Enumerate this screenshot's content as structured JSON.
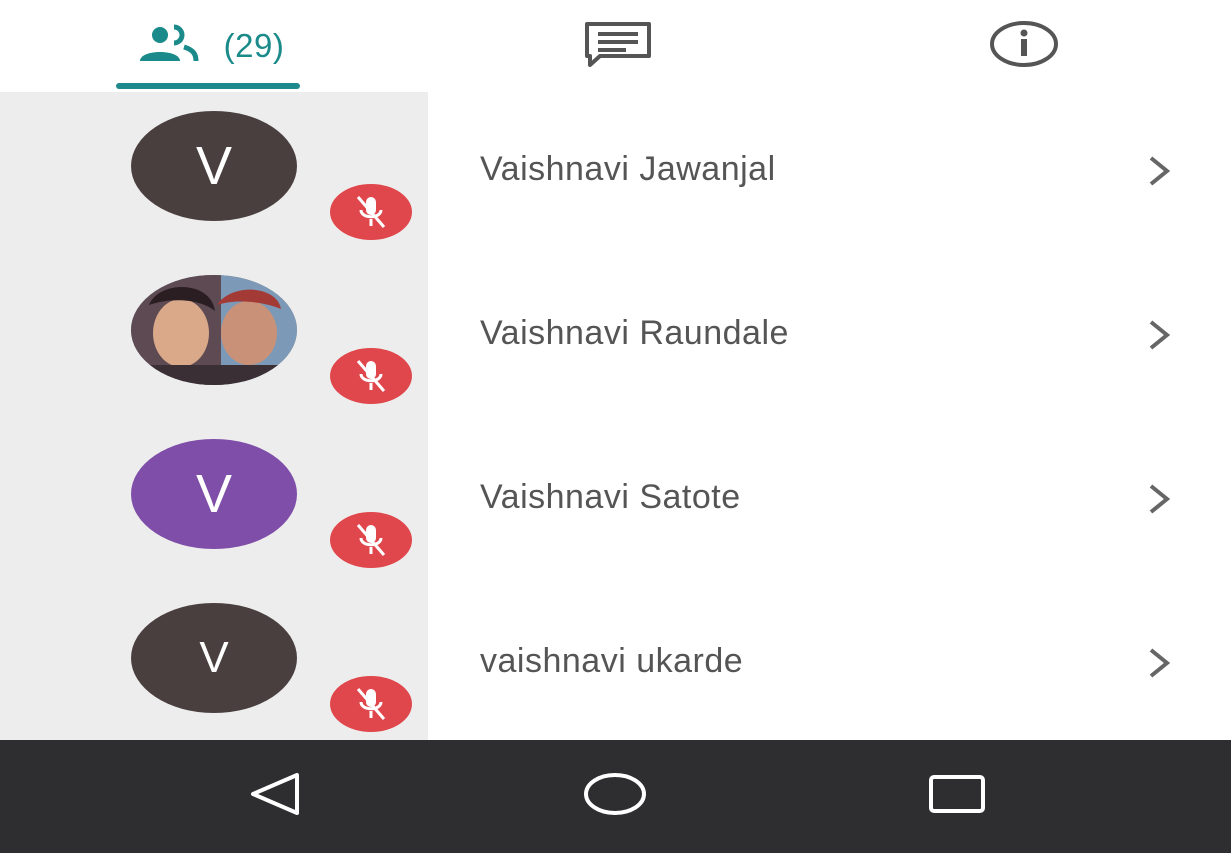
{
  "tabs": {
    "participants_count": "(29)",
    "icons": [
      "people-icon",
      "chat-icon",
      "info-icon"
    ],
    "active_color": "#1f8a8c"
  },
  "participants": [
    {
      "name": "Vaishnavi Jawanjal",
      "initial": "V",
      "avatar_color": "#4a3f3f",
      "muted": true
    },
    {
      "name": "Vaishnavi Raundale",
      "initial": "",
      "avatar_color": "#8a6a5a",
      "photo": true,
      "muted": true
    },
    {
      "name": "Vaishnavi Satote",
      "initial": "V",
      "avatar_color": "#7e4ea8",
      "muted": true
    },
    {
      "name": "vaishnavi ukarde",
      "initial": "V",
      "avatar_color": "#4a3f3f",
      "muted": true
    }
  ],
  "mute_color": "#e0474c",
  "navbar": {
    "icons": [
      "back-icon",
      "home-icon",
      "recents-icon"
    ],
    "background": "#2e2e30"
  }
}
